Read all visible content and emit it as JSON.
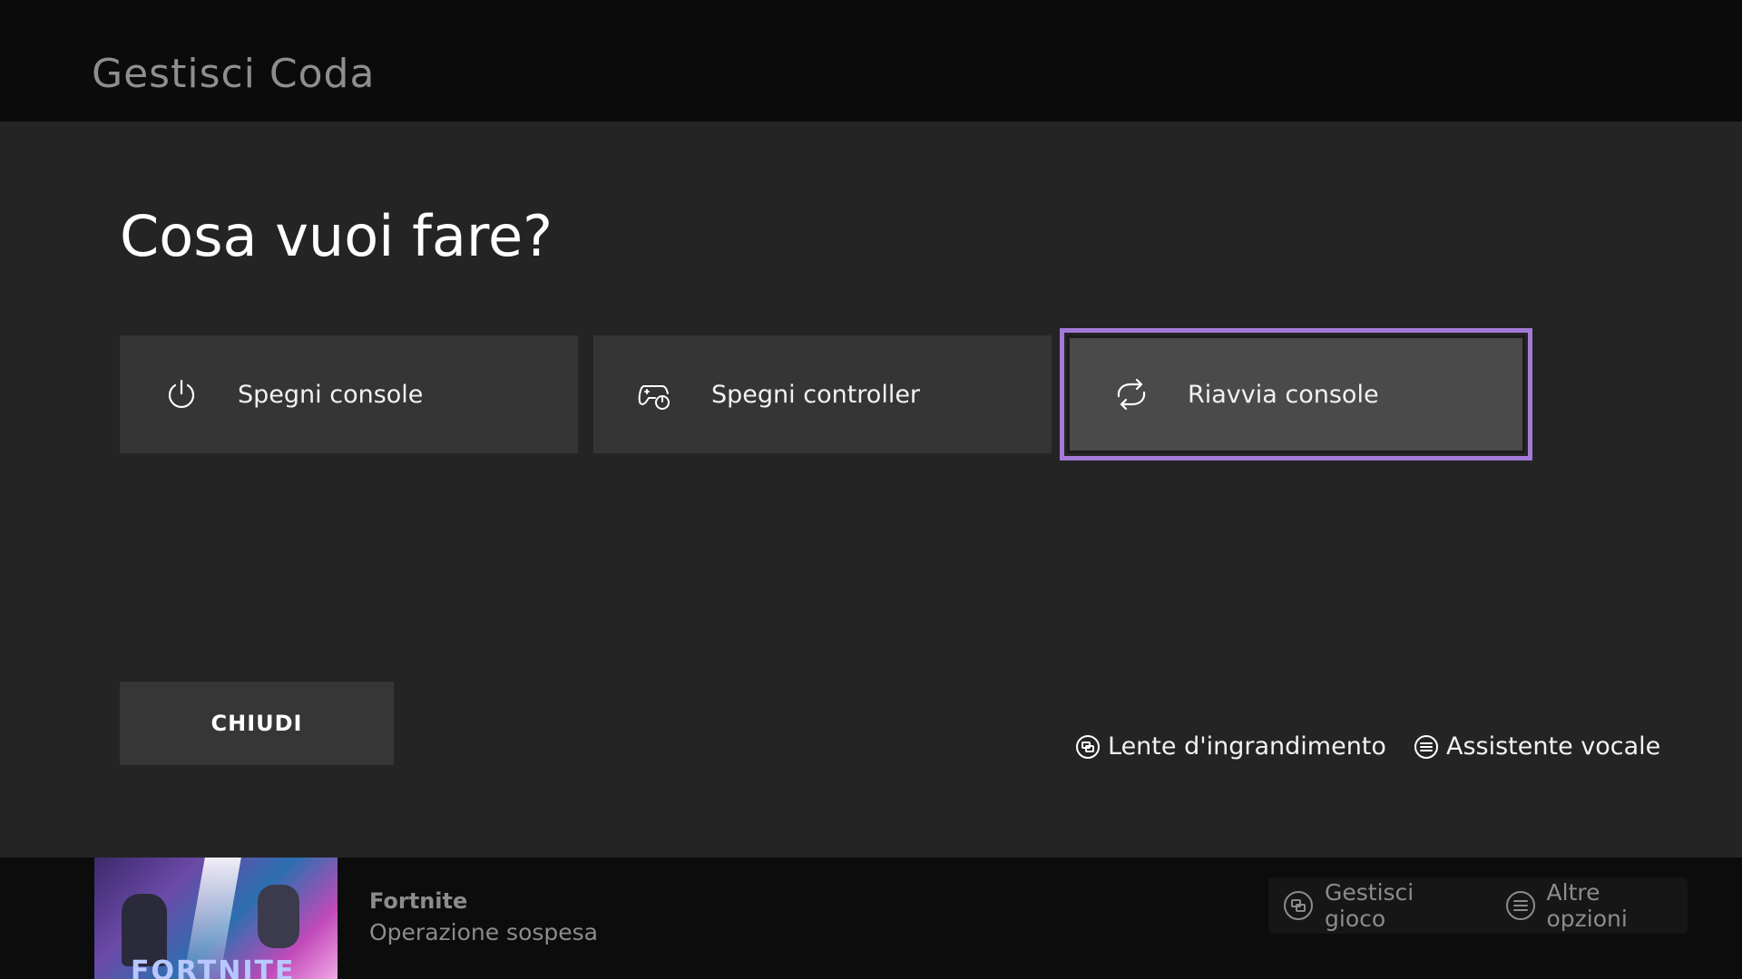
{
  "header": {
    "title": "Gestisci Coda"
  },
  "dialog": {
    "heading": "Cosa vuoi fare?",
    "options": [
      {
        "label": "Spegni console",
        "icon": "power-icon"
      },
      {
        "label": "Spegni controller",
        "icon": "controller-power-icon"
      },
      {
        "label": "Riavvia console",
        "icon": "restart-icon",
        "focused": true
      }
    ],
    "close_label": "CHIUDI",
    "accessibility": [
      {
        "label": "Lente d'ingrandimento",
        "icon": "view-button-icon"
      },
      {
        "label": "Assistente vocale",
        "icon": "menu-button-icon"
      }
    ]
  },
  "footer": {
    "game_name": "Fortnite",
    "game_status": "Operazione sospesa",
    "thumbnail_logo": "FORTNITE",
    "hints": [
      {
        "label": "Gestisci gioco",
        "icon": "view-button-icon"
      },
      {
        "label": "Altre opzioni",
        "icon": "menu-button-icon"
      }
    ]
  },
  "colors": {
    "focus_outline": "#a479d8",
    "overlay_bg": "#242424",
    "tile_bg": "#353535"
  }
}
